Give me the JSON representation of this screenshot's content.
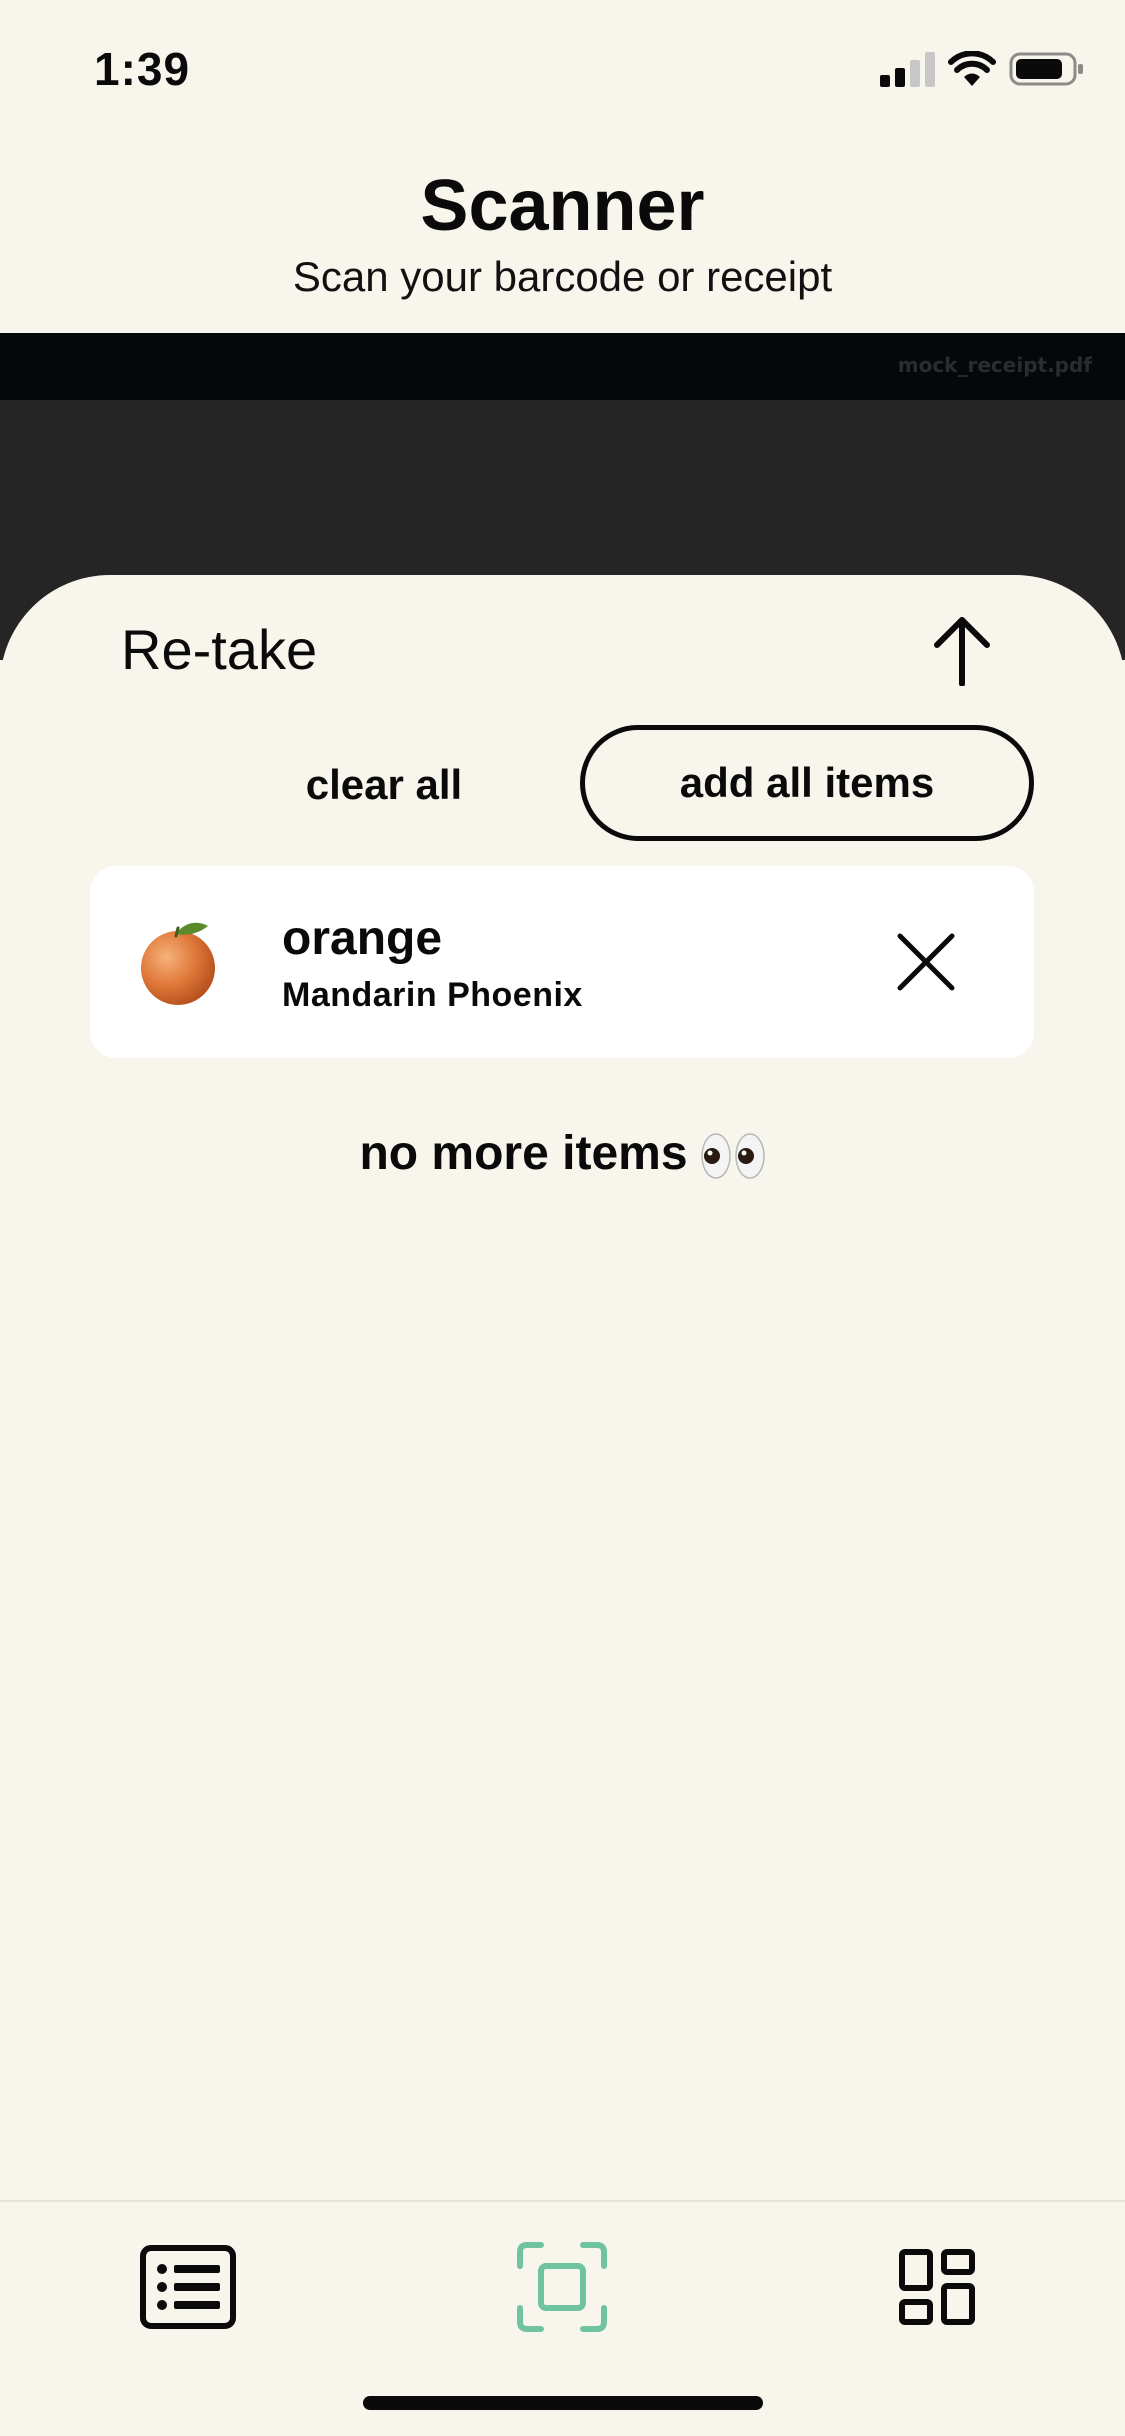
{
  "status_bar": {
    "time": "1:39"
  },
  "header": {
    "title": "Scanner",
    "subtitle": "Scan your barcode or receipt"
  },
  "camera": {
    "filename": "mock_receipt.pdf"
  },
  "sheet": {
    "retake_label": "Re-take",
    "clear_all_label": "clear all",
    "add_all_label": "add all items",
    "items": [
      {
        "name": "orange",
        "brand": "Mandarin Phoenix",
        "icon": "orange-fruit-icon"
      }
    ],
    "end_message": "no more items"
  },
  "tab_bar": {
    "tabs": [
      {
        "name": "list",
        "icon": "list-icon",
        "active": false
      },
      {
        "name": "scanner",
        "icon": "scan-icon",
        "active": true
      },
      {
        "name": "dashboard",
        "icon": "dashboard-icon",
        "active": false
      }
    ]
  },
  "colors": {
    "background": "#f8f5ed",
    "card": "#ffffff",
    "accent": "#6fc3a0",
    "text": "#0a0a0a",
    "camera_dark": "#252525"
  }
}
